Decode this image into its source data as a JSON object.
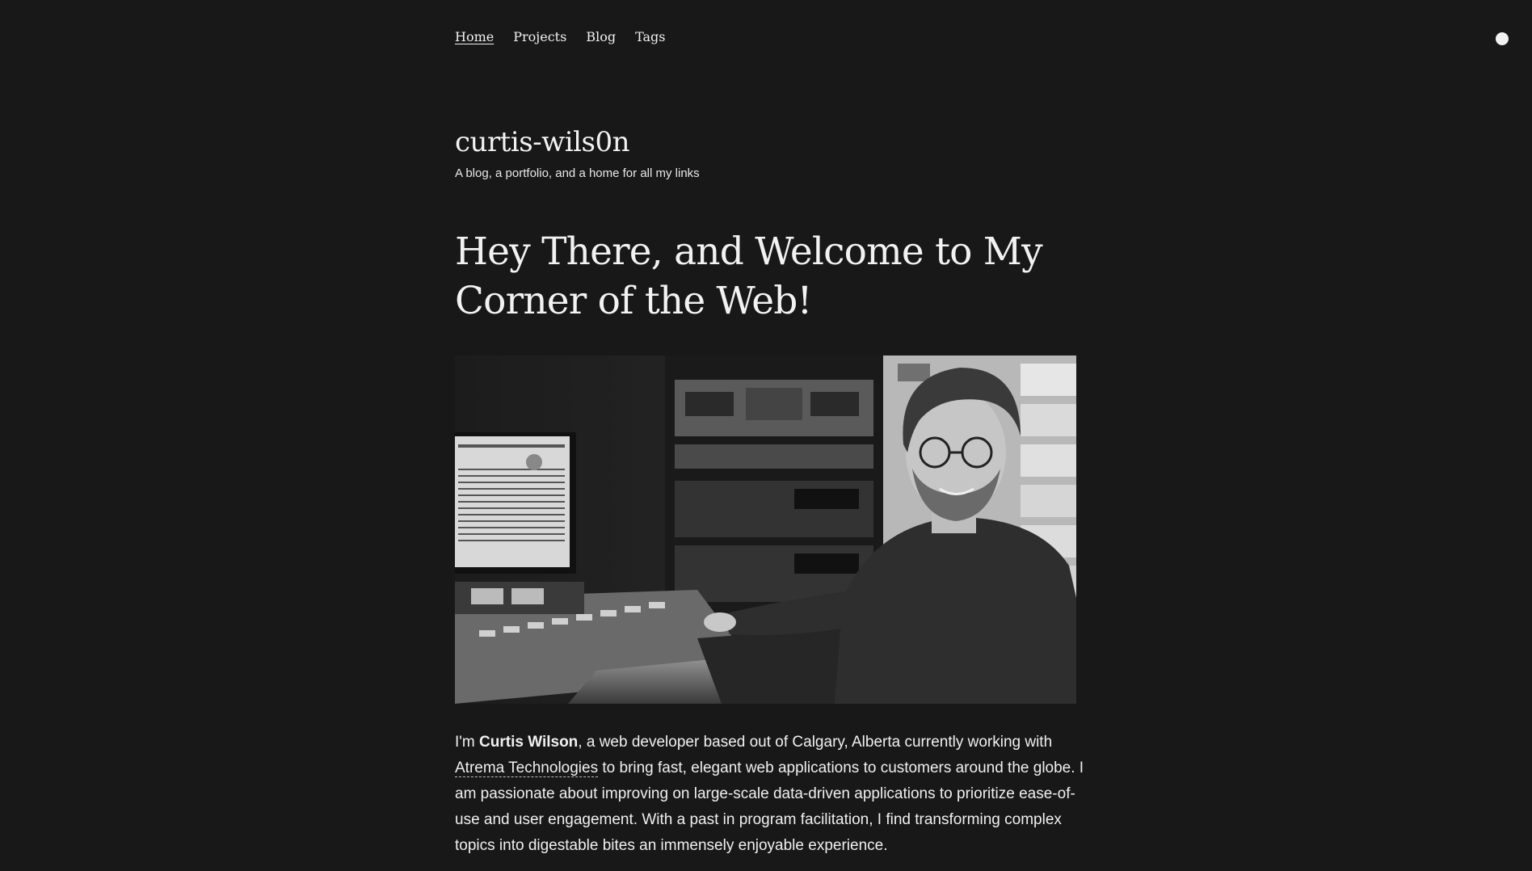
{
  "nav": {
    "items": [
      {
        "label": "Home",
        "active": true
      },
      {
        "label": "Projects",
        "active": false
      },
      {
        "label": "Blog",
        "active": false
      },
      {
        "label": "Tags",
        "active": false
      }
    ]
  },
  "theme_toggle": {
    "icon": "circle-icon",
    "color": "#f2f2f2"
  },
  "site": {
    "title": "curtis-wils0n",
    "subtitle": "A blog, a portfolio, and a home for all my links"
  },
  "hero": {
    "heading": "Hey There, and Welcome to My Corner of the Web!"
  },
  "photo": {
    "description_icon": "photo-radio-studio"
  },
  "bio": {
    "intro": "I'm ",
    "name": "Curtis Wilson",
    "part1": ", a web developer based out of Calgary, Alberta currently working with ",
    "company": "Atrema Technologies",
    "part2": " to bring fast, elegant web applications to customers around the globe. I am passionate about improving on large-scale data-driven applications to prioritize ease-of-use and user engagement. With a past in program facilitation, I find transforming complex topics into digestable bites an immensely enjoyable experience."
  },
  "colors": {
    "background": "#181818",
    "text": "#f2f2f2"
  }
}
